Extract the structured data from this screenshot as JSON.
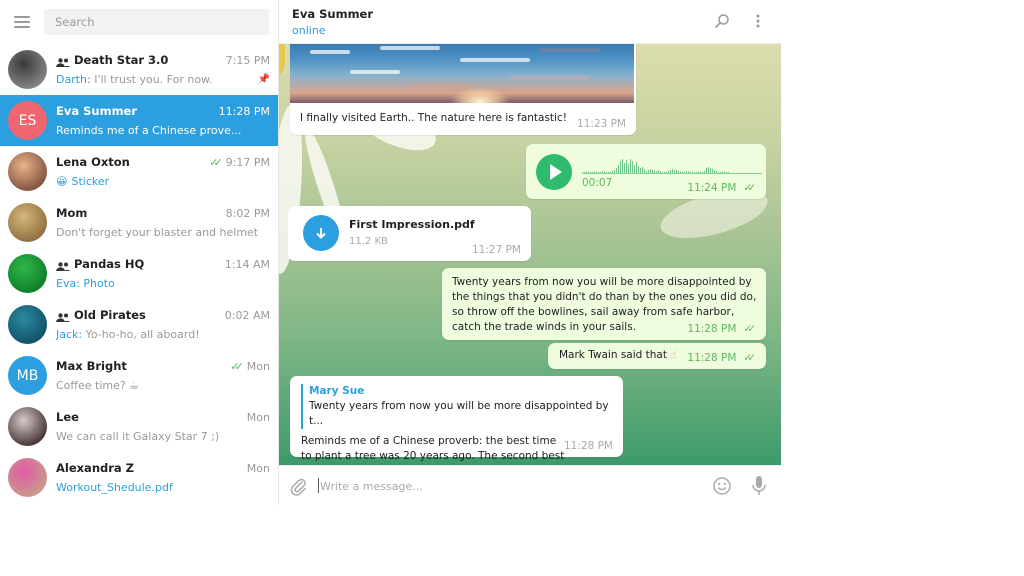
{
  "sidebar": {
    "menu_icon": "hamburger-menu-icon",
    "search_placeholder": "Search",
    "chats": [
      {
        "name": "Death Star 3.0",
        "is_group": true,
        "time": "7:15 PM",
        "sender": "Darth:",
        "preview": " I'll trust you. For now.",
        "pinned": true,
        "avatar_colors": [
          "#3a3a3a",
          "#8a8a8a"
        ]
      },
      {
        "name": "Eva Summer",
        "is_group": false,
        "time": "11:28 PM",
        "preview": "Reminds me of a Chinese prove...",
        "initials": "ES",
        "avatar_color": "#f0666e",
        "active": true
      },
      {
        "name": "Lena Oxton",
        "is_group": false,
        "time": "9:17 PM",
        "read": true,
        "preview_emoji": "😀",
        "preview": "Sticker",
        "preview_link": true,
        "avatar_colors": [
          "#e9b489",
          "#7a4b3a"
        ]
      },
      {
        "name": "Mom",
        "is_group": false,
        "time": "8:02 PM",
        "preview": "Don't forget your blaster and helmet",
        "avatar_colors": [
          "#d6b77a",
          "#8a6a3c"
        ]
      },
      {
        "name": "Pandas HQ",
        "is_group": true,
        "time": "1:14 AM",
        "sender": "Eva:",
        "preview": " Photo",
        "preview_link": true,
        "avatar_colors": [
          "#2fb84a",
          "#0b7a26"
        ]
      },
      {
        "name": "Old Pirates",
        "is_group": true,
        "time": "0:02 AM",
        "sender": "Jack:",
        "preview": " Yo-ho-ho, all aboard!",
        "avatar_colors": [
          "#2a8aa3",
          "#0f4d61"
        ]
      },
      {
        "name": "Max Bright",
        "is_group": false,
        "time": "Mon",
        "read": true,
        "preview": "Coffee time? ☕",
        "initials": "MB",
        "avatar_color": "#2c9fe0"
      },
      {
        "name": "Lee",
        "is_group": false,
        "time": "Mon",
        "preview": "We can call it Galaxy Star 7 ;)",
        "avatar_colors": [
          "#d9c8c8",
          "#3a2a2a"
        ]
      },
      {
        "name": "Alexandra Z",
        "is_group": false,
        "time": "Mon",
        "preview": "Workout_Shedule.pdf",
        "preview_link": true,
        "avatar_colors": [
          "#e05aa6",
          "#c9a088"
        ]
      }
    ]
  },
  "chat": {
    "title": "Eva Summer",
    "status": "online",
    "search_icon": "search-icon",
    "more_icon": "more-vertical-icon",
    "messages": {
      "photo": {
        "caption": "I finally visited Earth.. The nature here is fantastic!",
        "time": "11:23 PM"
      },
      "voice": {
        "duration": "00:07",
        "time": "11:24 PM",
        "ticks": "✓✓"
      },
      "file": {
        "name": "First Impression.pdf",
        "size": "11.2 KB",
        "time": "11:27 PM"
      },
      "quote": {
        "text": "Twenty years from now you will be more disappointed by the things that you didn't do than by the ones you did do, so throw off the bowlines, sail away from safe harbor, catch the trade winds in your sails.",
        "time": "11:28 PM",
        "ticks": "✓✓"
      },
      "twain": {
        "text": "Mark Twain said that",
        "emoji": "☝",
        "time": "11:28 PM",
        "ticks": "✓✓"
      },
      "reply": {
        "reply_to_name": "Mary Sue",
        "reply_to_text": "Twenty years from now you will be more disappointed by t...",
        "text": "Reminds me of a Chinese proverb: the best time to plant a tree was 20 years ago. The second best time is now.",
        "time": "11:28 PM"
      }
    },
    "composer": {
      "placeholder": "Write a message...",
      "value": ""
    }
  },
  "colors": {
    "accent": "#2c9fe0",
    "active_row": "#2c9fe0",
    "read_check": "#4bbf5b",
    "outgoing_bubble": "#effdde",
    "play_button": "#2fbb6e"
  }
}
